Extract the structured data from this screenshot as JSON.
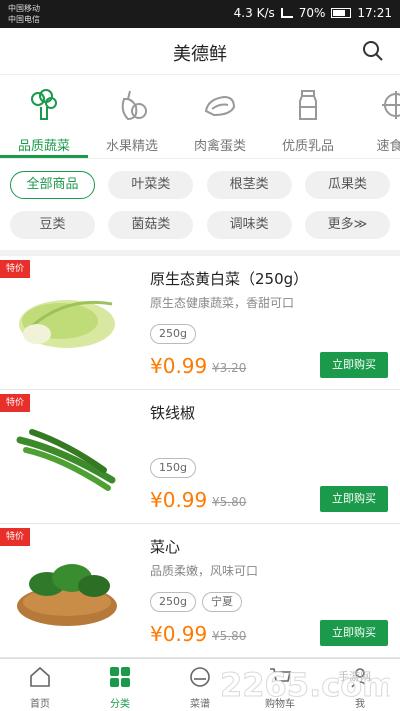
{
  "status_bar": {
    "carrier1": "中国移动",
    "carrier2": "中国电信",
    "network_speed": "4.3 K/s",
    "battery": "70%",
    "time": "17:21"
  },
  "header": {
    "title": "美德鲜"
  },
  "categories": [
    {
      "label": "品质蔬菜",
      "icon": "broccoli-icon",
      "active": true
    },
    {
      "label": "水果精选",
      "icon": "fruit-icon"
    },
    {
      "label": "肉禽蛋类",
      "icon": "meat-icon"
    },
    {
      "label": "优质乳品",
      "icon": "milk-bottle-icon"
    },
    {
      "label": "速食冷",
      "icon": "frozen-food-icon"
    }
  ],
  "filters": {
    "row1": [
      "全部商品",
      "叶菜类",
      "根茎类",
      "瓜果类"
    ],
    "row2": [
      "豆类",
      "菌菇类",
      "调味类",
      "更多≫"
    ],
    "active": "全部商品"
  },
  "products": [
    {
      "badge": "特价",
      "name": "原生态黄白菜（250g）",
      "desc": "原生态健康蔬菜，香甜可口",
      "tags": [
        "250g"
      ],
      "price": "¥0.99",
      "original_price": "¥3.20",
      "buy_label": "立即购买",
      "image": "napa-cabbage"
    },
    {
      "badge": "特价",
      "name": "铁线椒",
      "desc": "",
      "tags": [
        "150g"
      ],
      "price": "¥0.99",
      "original_price": "¥5.80",
      "buy_label": "立即购买",
      "image": "green-pepper"
    },
    {
      "badge": "特价",
      "name": "菜心",
      "desc": "品质柔嫩，风味可口",
      "tags": [
        "250g",
        "宁夏"
      ],
      "price": "¥0.99",
      "original_price": "¥5.80",
      "buy_label": "立即购买",
      "image": "choy-sum"
    }
  ],
  "tabbar": [
    {
      "label": "首页",
      "icon": "home-icon"
    },
    {
      "label": "分类",
      "icon": "category-grid-icon",
      "active": true
    },
    {
      "label": "菜谱",
      "icon": "recipe-icon"
    },
    {
      "label": "购物车",
      "icon": "cart-icon"
    },
    {
      "label": "我",
      "icon": "profile-icon"
    }
  ],
  "watermark": {
    "text": "2265.com",
    "sub": "手游网"
  },
  "colors": {
    "accent": "#1a9a4a",
    "price": "#ff7a00",
    "badge": "#e8302b"
  }
}
